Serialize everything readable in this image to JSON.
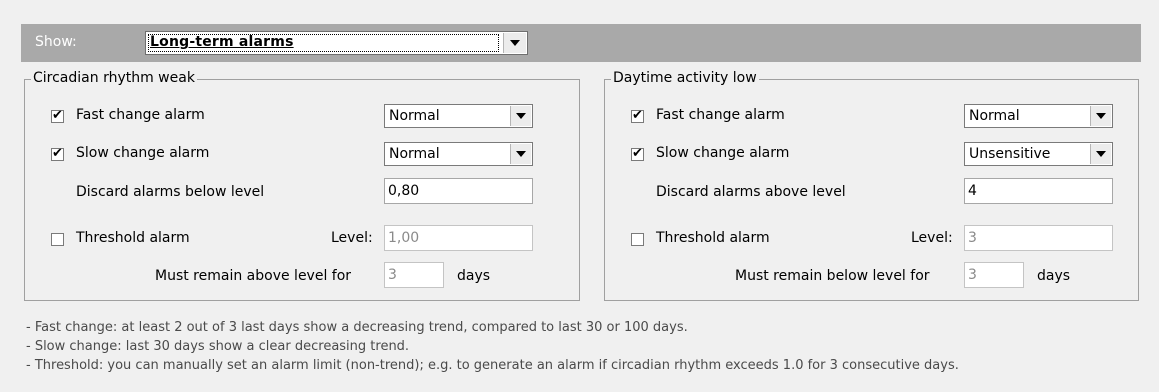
{
  "show": {
    "label": "Show:",
    "selected": "Long-term alarms"
  },
  "left": {
    "title": "Circadian rhythm weak",
    "fast": {
      "label": "Fast change alarm",
      "checked": true,
      "sensitivity": "Normal"
    },
    "slow": {
      "label": "Slow change alarm",
      "checked": true,
      "sensitivity": "Normal"
    },
    "discard": {
      "label": "Discard alarms below level",
      "value": "0,80"
    },
    "threshold": {
      "label": "Threshold alarm",
      "checked": false,
      "level_label": "Level:",
      "level_value": "1,00"
    },
    "remain": {
      "label": "Must remain above level for",
      "value": "3",
      "unit": "days"
    }
  },
  "right": {
    "title": "Daytime activity low",
    "fast": {
      "label": "Fast change alarm",
      "checked": true,
      "sensitivity": "Normal"
    },
    "slow": {
      "label": "Slow change alarm",
      "checked": true,
      "sensitivity": "Unsensitive"
    },
    "discard": {
      "label": "Discard alarms above level",
      "value": "4"
    },
    "threshold": {
      "label": "Threshold alarm",
      "checked": false,
      "level_label": "Level:",
      "level_value": "3"
    },
    "remain": {
      "label": "Must remain below level for",
      "value": "3",
      "unit": "days"
    }
  },
  "notes": [
    "- Fast change: at least 2 out of 3 last days show a decreasing trend, compared to last 30 or 100 days.",
    "- Slow change: last 30 days show a clear decreasing trend.",
    "- Threshold: you can manually set an alarm limit (non-trend); e.g. to generate an alarm if circadian rhythm exceeds 1.0 for 3 consecutive days."
  ],
  "icons": {
    "dropdown": "chevron-down-icon",
    "check": "checkmark-icon"
  }
}
